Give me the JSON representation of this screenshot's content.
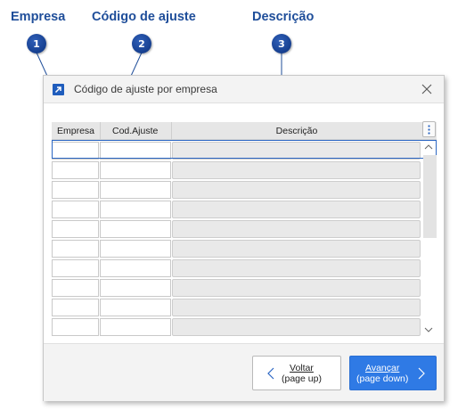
{
  "callouts": [
    {
      "label": "Empresa",
      "number": "1"
    },
    {
      "label": "Código de ajuste",
      "number": "2"
    },
    {
      "label": "Descrição",
      "number": "3"
    }
  ],
  "window": {
    "title": "Código de ajuste por empresa",
    "app_icon": "external-link-icon",
    "close_icon": "close-icon"
  },
  "grid": {
    "columns": [
      "Empresa",
      "Cod.Ajuste",
      "Descrição"
    ],
    "row_count": 10,
    "rows": [
      {
        "empresa": "",
        "cod_ajuste": "",
        "descricao": ""
      },
      {
        "empresa": "",
        "cod_ajuste": "",
        "descricao": ""
      },
      {
        "empresa": "",
        "cod_ajuste": "",
        "descricao": ""
      },
      {
        "empresa": "",
        "cod_ajuste": "",
        "descricao": ""
      },
      {
        "empresa": "",
        "cod_ajuste": "",
        "descricao": ""
      },
      {
        "empresa": "",
        "cod_ajuste": "",
        "descricao": ""
      },
      {
        "empresa": "",
        "cod_ajuste": "",
        "descricao": ""
      },
      {
        "empresa": "",
        "cod_ajuste": "",
        "descricao": ""
      },
      {
        "empresa": "",
        "cod_ajuste": "",
        "descricao": ""
      },
      {
        "empresa": "",
        "cod_ajuste": "",
        "descricao": ""
      }
    ],
    "menu_icon": "kebab-menu-icon"
  },
  "footer": {
    "prev_label": "Voltar",
    "prev_sub": "(page up)",
    "next_label": "Avançar",
    "next_sub": "(page down)"
  },
  "colors": {
    "callout": "#1f4e9a",
    "accent": "#2f7ae5",
    "selection": "#2b66c3"
  }
}
